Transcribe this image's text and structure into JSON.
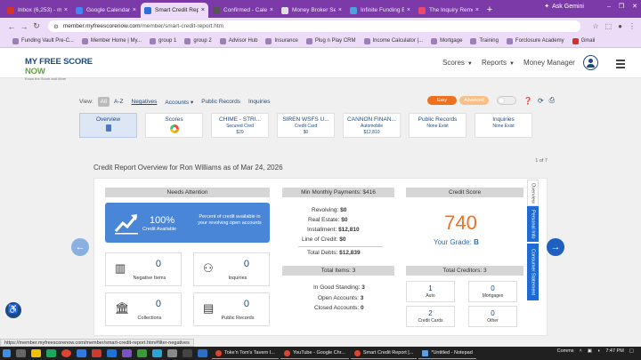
{
  "browser": {
    "tabs": [
      {
        "title": "Inbox (6,253) - m",
        "color": "#d93025",
        "active": false
      },
      {
        "title": "Google Calendar",
        "color": "#4285f4",
        "active": false
      },
      {
        "title": "Smart Credit Repo",
        "color": "#2f6fd6",
        "active": true
      },
      {
        "title": "Confirmed - Cale",
        "color": "#555555",
        "active": false
      },
      {
        "title": "Money Broker Sec",
        "color": "#e0e0e0",
        "active": false
      },
      {
        "title": "Infinite Funding E",
        "color": "#4aa3df",
        "active": false
      },
      {
        "title": "The Inquiry Remo",
        "color": "#e84a70",
        "active": false
      }
    ],
    "ask_gemini": "Ask Gemini",
    "url_domain": "member.myfreescorenow.com",
    "url_path": "/member/smart-credit-report.htm",
    "bookmarks": [
      "Funding Vault Pre-C...",
      "Member Home | My...",
      "group 1",
      "group 2",
      "Advisor Hub",
      "Insurance",
      "Plug n Play CRM",
      "Income Calculator |...",
      "Mortgage",
      "Training",
      "Forclosure Academy",
      "Gmail"
    ]
  },
  "site": {
    "logo_my": "MY ",
    "logo_free": "FREE SCORE",
    "logo_now": "NOW",
    "logo_tag": "Know the Score and More",
    "nav": {
      "scores": "Scores",
      "reports": "Reports",
      "money_manager": "Money Manager"
    }
  },
  "view": {
    "label": "View:",
    "all": "All",
    "az": "A-Z",
    "negatives": "Negatives",
    "accounts": "Accounts",
    "public_records": "Public Records",
    "inquiries": "Inquiries",
    "easy": "Easy",
    "advanced": "Advanced"
  },
  "cards": [
    {
      "title": "Overview",
      "sub": ""
    },
    {
      "title": "Scores",
      "sub": ""
    },
    {
      "title": "CHIME - STRI...",
      "sub": "Secured Cred",
      "sub2": "$29"
    },
    {
      "title": "SIREN WSFS U...",
      "sub": "Credit Card",
      "sub2": "$0"
    },
    {
      "title": "CANNON FINAN...",
      "sub": "Automobile",
      "sub2": "$12,810"
    },
    {
      "title": "Public Records",
      "sub": "None Exist",
      "sub2": ""
    },
    {
      "title": "Inquiries",
      "sub": "None Exist",
      "sub2": ""
    }
  ],
  "overview": {
    "title": "Credit Report Overview for Ron Williams as of Mar 24, 2026",
    "page": "1 of 7",
    "needs_attention": "Needs Attention",
    "credit_pct": "100%",
    "credit_label": "Credit Available",
    "credit_desc": "Percent of credit available in your revolving open accounts",
    "negative_items": {
      "value": "0",
      "label": "Negative Items"
    },
    "inquiries": {
      "value": "0",
      "label": "Inquiries"
    },
    "collections": {
      "value": "0",
      "label": "Collections"
    },
    "public_records": {
      "value": "0",
      "label": "Public Records"
    },
    "min_payments_header": "Min Monthly Payments: $416",
    "revolving": {
      "label": "Revolving:",
      "value": "$0"
    },
    "real_estate": {
      "label": "Real Estate:",
      "value": "$0"
    },
    "installment": {
      "label": "Installment:",
      "value": "$12,810"
    },
    "line_of_credit": {
      "label": "Line of Credit:",
      "value": "$0"
    },
    "total_debts": {
      "label": "Total Debts:",
      "value": "$12,839"
    },
    "total_items_header": "Total Items: 3",
    "good_standing": {
      "label": "In Good Standing:",
      "value": "3"
    },
    "open_accounts": {
      "label": "Open Accounts:",
      "value": "3"
    },
    "closed_accounts": {
      "label": "Closed Accounts:",
      "value": "0"
    },
    "credit_score_header": "Credit Score",
    "score": "740",
    "grade_label": "Your Grade: ",
    "grade": "B",
    "total_creditors_header": "Total Creditors: 3",
    "auto": {
      "value": "1",
      "label": "Auto"
    },
    "mortgages": {
      "value": "0",
      "label": "Mortgages"
    },
    "credit_cards": {
      "value": "2",
      "label": "Credit Cards"
    },
    "other": {
      "value": "0",
      "label": "Other"
    },
    "vtabs": [
      "Overview",
      "Personal Info",
      "Consumer Statement"
    ]
  },
  "status_url": "https://member.myfreescorenow.com/member/smart-credit-report.htm#filter-negatives",
  "taskbar": {
    "items": [
      "Toke'n Tom's Tavern I...",
      "YouTube - Google Chr...",
      "Smart Credit Report |...",
      "*Untitled - Notepad"
    ],
    "tray_label": "Comms",
    "time": "7:47 PM"
  },
  "colors": {
    "accent": "#1f4a7c",
    "score": "#f07020",
    "easy": "#f07020",
    "advanced": "#f5c08a",
    "tab_bar": "#7b3aa8"
  }
}
